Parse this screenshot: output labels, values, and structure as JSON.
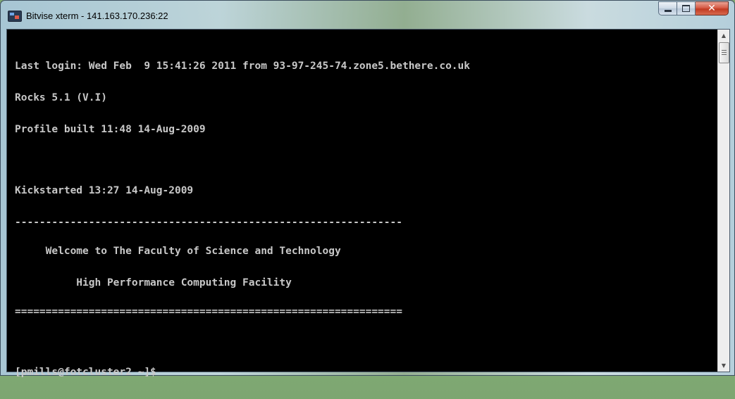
{
  "window": {
    "title": "Bitvise xterm - 141.163.170.236:22",
    "controls": {
      "minimize": "",
      "maximize": "",
      "close": "✕"
    }
  },
  "terminal": {
    "lines": [
      "Last login: Wed Feb  9 15:41:26 2011 from 93-97-245-74.zone5.bethere.co.uk",
      "Rocks 5.1 (V.I)",
      "Profile built 11:48 14-Aug-2009",
      "",
      "Kickstarted 13:27 14-Aug-2009",
      "---------------------------------------------------------------",
      "     Welcome to The Faculty of Science and Technology",
      "          High Performance Computing Facility",
      "===============================================================",
      "",
      "[pmills@fotcluster2 ~]$"
    ]
  },
  "scrollbar": {
    "up": "▲",
    "down": "▼"
  }
}
